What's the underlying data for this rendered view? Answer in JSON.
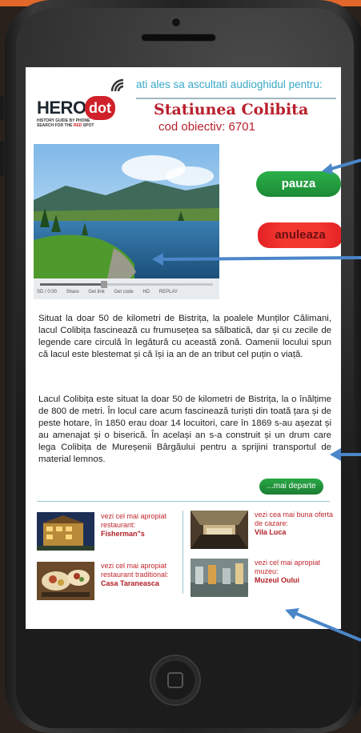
{
  "colors": {
    "accent_blue": "#39a8c8",
    "brand_red": "#b8202d",
    "pause_green": "#1c8a36",
    "cancel_red": "#e21f23",
    "arrow_blue": "#4a86c8"
  },
  "brand": {
    "name": "HERO",
    "badge": "dot",
    "tagline_line1": "HISTORY GUIDE BY PHONE",
    "tagline_line2_prefix": "SEARCH FOR THE ",
    "tagline_line2_red": "RED",
    "tagline_line2_suffix": " SPOT"
  },
  "header": {
    "intro": "ati ales sa ascultati audioghidul pentru:",
    "destination": "Statiunea Colibita",
    "objective_code": "cod obiectiv: 6701"
  },
  "video": {
    "progress_fraction": 0.37,
    "controls": [
      "SD / 0:00",
      "Share",
      "Get link",
      "Get code",
      "HD",
      "REPLAY"
    ]
  },
  "buttons": {
    "pause": "pauza",
    "cancel": "anuleaza",
    "more": "...mai departe"
  },
  "description": {
    "paragraph1": "Situat la doar 50 de kilometri de Bistrița, la poalele Munților Călimani, lacul Colibița fascinează cu frumusețea sa sălbatică, dar și cu zecile de legende care circulă în legătură cu această zonă. Oamenii locului spun că lacul este blestemat și că își ia an de an tribut cel puțin o viață.",
    "paragraph2": "Lacul Colibița este situat la doar 50 de kilometri de Bistrița, la o înălțime de 800 de metri. În locul care acum fascinează turiști din toată țara și de peste hotare, în 1850 erau doar 14 locuitori, care în 1869 s-au așezat și au amenajat și o biserică. În același an s-a construit și un drum care lega Colibița de Mureșenii Bârgăului pentru a sprijini transportul de material lemnos."
  },
  "poi": [
    {
      "label": "vezi cel mai apropiat restaurant:",
      "name": "Fisherman\"s"
    },
    {
      "label": "vezi cea mai buna oferta de cazare:",
      "name": "Vila Luca"
    },
    {
      "label": "vezi cel mai apropiat restaurant traditional:",
      "name": "Casa Taraneasca"
    },
    {
      "label": "vezi cel mai apropiat muzeu:",
      "name": "Muzeul Oului"
    }
  ]
}
